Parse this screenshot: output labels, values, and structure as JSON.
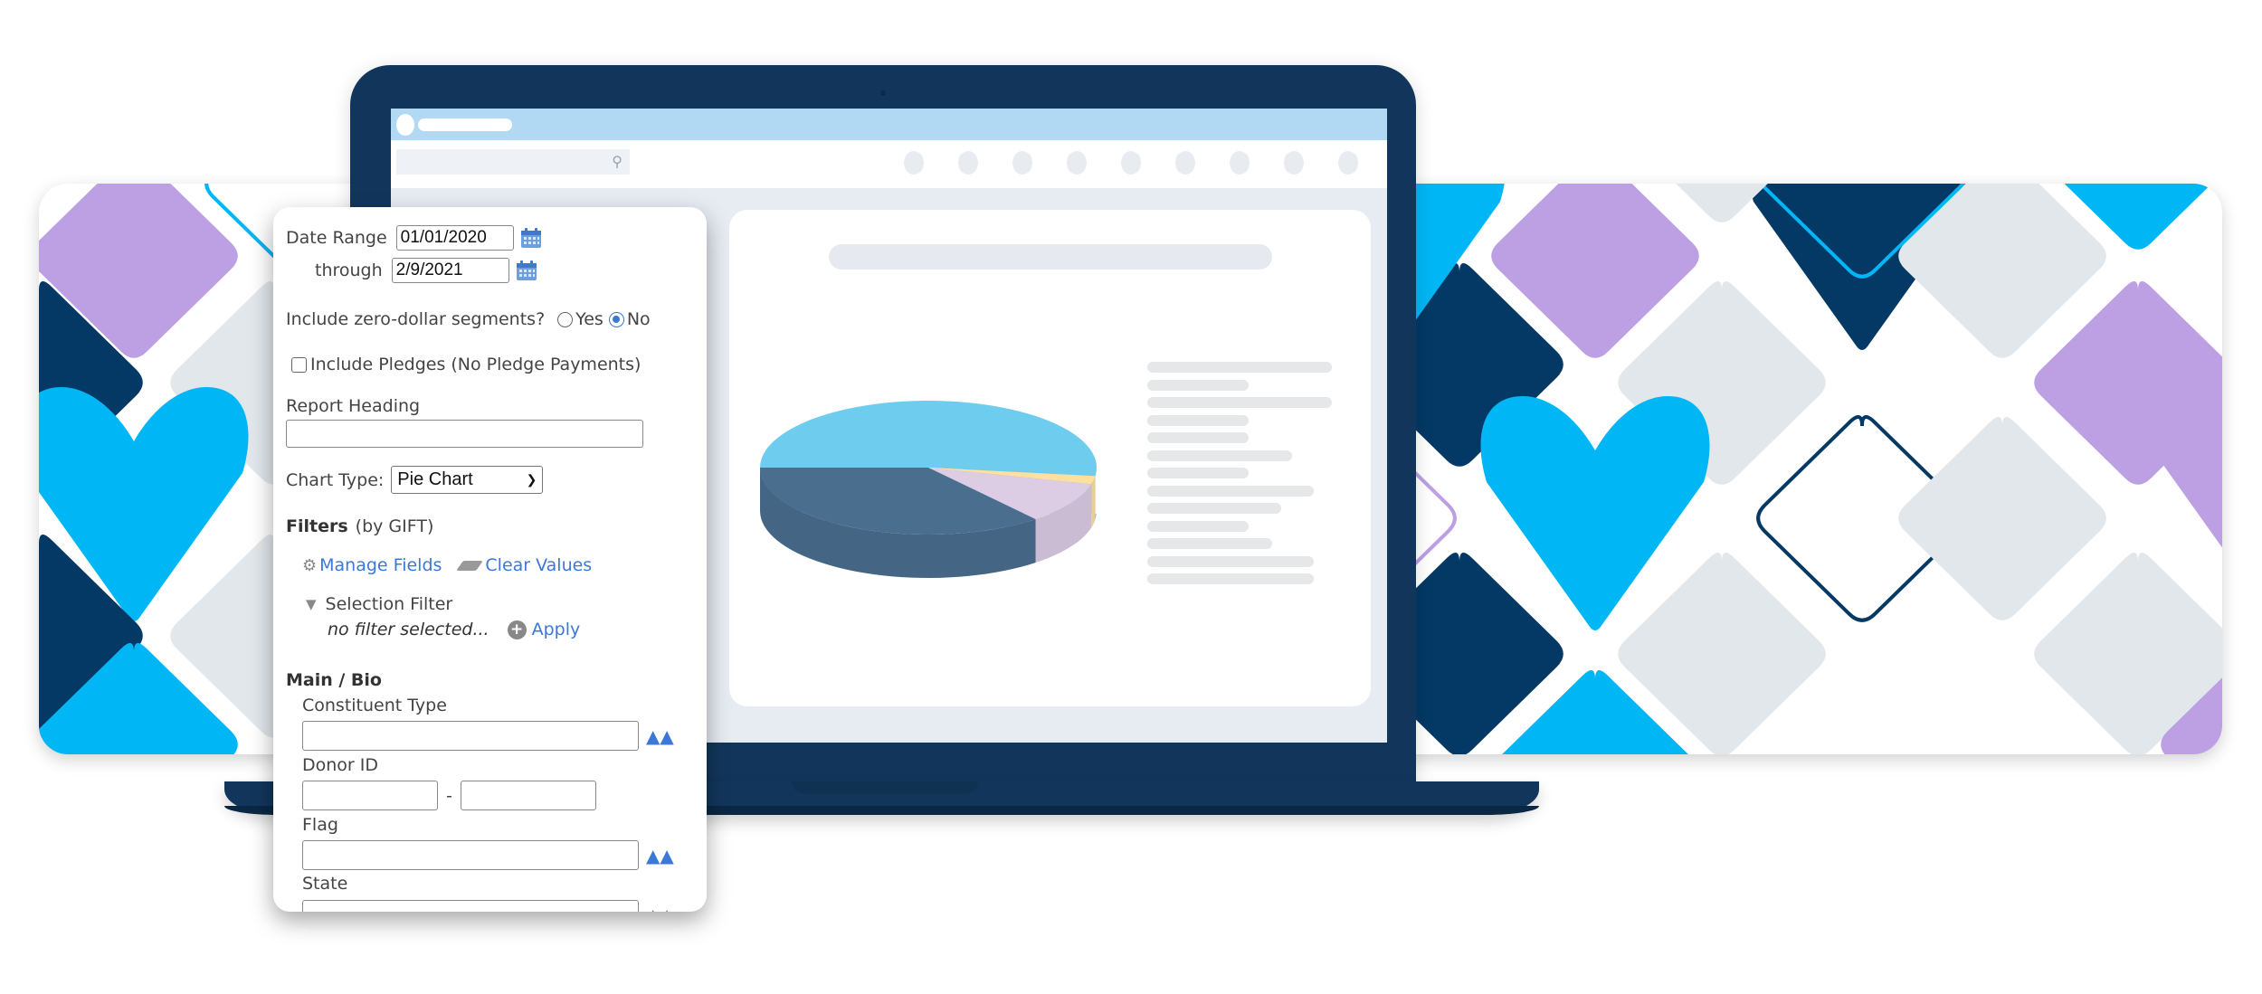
{
  "colors": {
    "laptop": "#12365b",
    "topbar": "#b1d9f3",
    "screen_bg": "#e7ecf3",
    "pattern_purple": "#bd9fe3",
    "pattern_navy": "#033964",
    "pattern_sky": "#00b6f5",
    "pattern_gray": "#e2e7eb",
    "link": "#3b78d8"
  },
  "screen": {
    "search_icon": "search-icon",
    "nav_icon_count": 9
  },
  "report_form": {
    "date_range_label": "Date Range",
    "date_from": "01/01/2020",
    "through_label": "through",
    "date_to": "2/9/2021",
    "calendar_icon": "calendar-icon",
    "zero_dollar_label": "Include zero-dollar segments?",
    "zero_dollar_options": [
      "Yes",
      "No"
    ],
    "zero_dollar_selected": "No",
    "include_pledges_label": "Include Pledges (No Pledge Payments)",
    "include_pledges_checked": false,
    "report_heading_label": "Report Heading",
    "report_heading_value": "",
    "chart_type_label": "Chart Type:",
    "chart_type_value": "Pie Chart",
    "filters_label": "Filters",
    "filters_scope": "(by GIFT)",
    "manage_fields": "Manage Fields",
    "clear_values": "Clear Values",
    "selection_filter_label": "Selection Filter",
    "selection_filter_value": "no filter selected...",
    "apply_label": "Apply",
    "section_main_bio": "Main / Bio",
    "fields": {
      "constituent_type": "Constituent Type",
      "donor_id": "Donor ID",
      "donor_id_separator": "-",
      "flag": "Flag",
      "state": "State"
    }
  },
  "chart_data": {
    "type": "pie",
    "title": "",
    "style": "3d",
    "slices": [
      {
        "label": "",
        "value": 52,
        "color": "#6ecdee"
      },
      {
        "label": "",
        "value": 2,
        "color": "#fddfa0"
      },
      {
        "label": "",
        "value": 10,
        "color": "#dccce4"
      },
      {
        "label": "",
        "value": 36,
        "color": "#4a6e8e"
      }
    ],
    "legend_placeholder_rows": 13,
    "legend_position": "right"
  }
}
